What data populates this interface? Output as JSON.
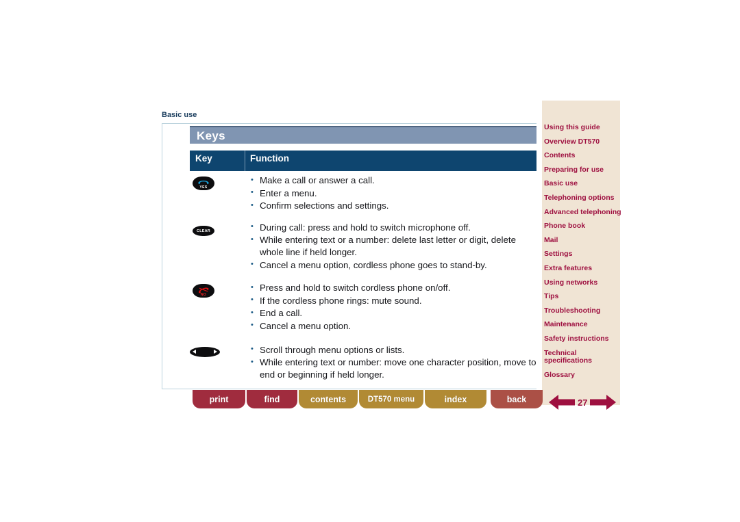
{
  "breadcrumb": "Basic use",
  "section": {
    "title": "Keys"
  },
  "table": {
    "headers": {
      "key": "Key",
      "function": "Function"
    },
    "rows": [
      {
        "key_icon": "yes-key-icon",
        "key_label": "YES",
        "functions": [
          "Make a call or answer a call.",
          "Enter a menu.",
          "Confirm selections and settings."
        ]
      },
      {
        "key_icon": "clear-key-icon",
        "key_label": "CLEAR",
        "functions": [
          "During call: press and hold to switch microphone off.",
          "While entering text or a number: delete last letter or digit, delete whole line if held longer.",
          "Cancel a menu option, cordless phone goes to stand-by."
        ]
      },
      {
        "key_icon": "no-key-icon",
        "key_label": "NO",
        "functions": [
          "Press and hold to switch cordless phone on/off.",
          "If the cordless phone rings: mute sound.",
          "End a call.",
          "Cancel a menu option."
        ]
      },
      {
        "key_icon": "scroll-key-icon",
        "key_label": "",
        "functions": [
          "Scroll through menu options or lists.",
          "While entering text or number: move one character position, move to end or beginning if held longer."
        ]
      }
    ]
  },
  "sidebar": {
    "items": [
      {
        "label": "Using this guide"
      },
      {
        "label": "Overview DT570"
      },
      {
        "label": "Contents"
      },
      {
        "label": "Preparing for use"
      },
      {
        "label": "Basic use"
      },
      {
        "label": "Telephoning options"
      },
      {
        "label": "Advanced telephoning"
      },
      {
        "label": "Phone book"
      },
      {
        "label": "Mail"
      },
      {
        "label": "Settings"
      },
      {
        "label": "Extra features"
      },
      {
        "label": "Using networks"
      },
      {
        "label": "Tips"
      },
      {
        "label": "Troubleshooting"
      },
      {
        "label": "Maintenance"
      },
      {
        "label": "Safety instructions"
      },
      {
        "label": "Technical specifications"
      },
      {
        "label": "Glossary"
      }
    ]
  },
  "toolbar": {
    "print": "print",
    "find": "find",
    "contents": "contents",
    "dt570_menu": "DT570 menu",
    "index": "index",
    "back": "back"
  },
  "page_nav": {
    "page_number": "27",
    "prev_icon": "arrow-left-icon",
    "next_icon": "arrow-right-icon"
  },
  "colors": {
    "section_bar": "#8095b2",
    "table_header": "#0e456f",
    "sidebar_bg": "#f0e4d4",
    "sidebar_link": "#9e1040",
    "toolbar_red": "#a02c3e",
    "toolbar_gold": "#b18a34",
    "toolbar_back": "#ab5046",
    "arrow": "#9e1040",
    "bullet": "#1b5b86"
  }
}
